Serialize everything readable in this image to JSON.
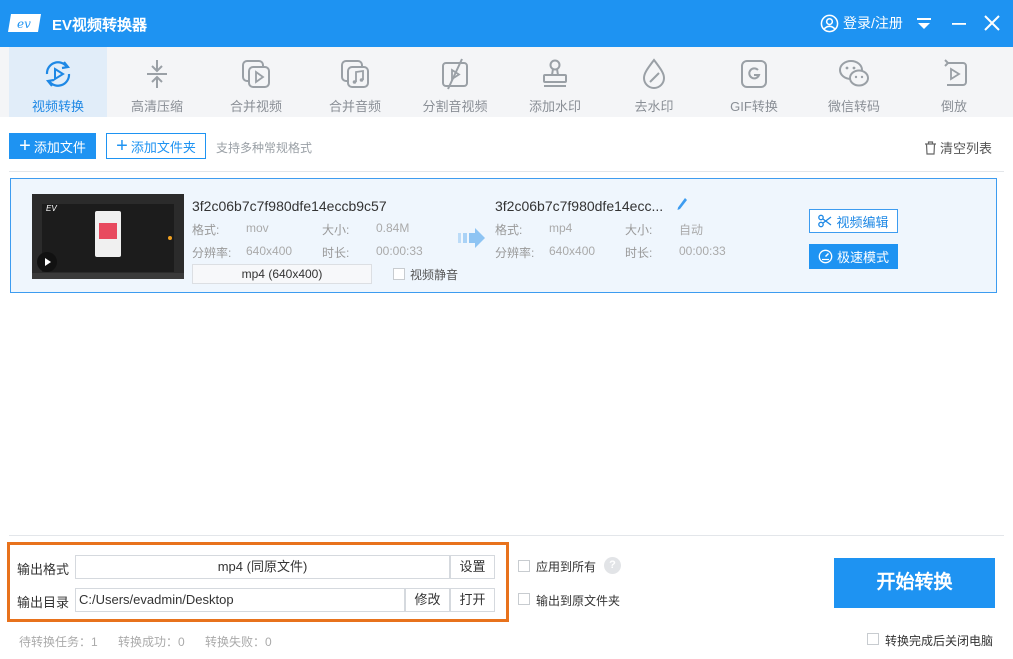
{
  "app": {
    "title": "EV视频转换器",
    "logo_text": "ev",
    "login": "登录/注册"
  },
  "toolbar": [
    {
      "label": "视频转换",
      "icon": "convert-icon",
      "active": true
    },
    {
      "label": "高清压缩",
      "icon": "compress-icon"
    },
    {
      "label": "合并视频",
      "icon": "merge-video-icon"
    },
    {
      "label": "合并音频",
      "icon": "merge-audio-icon"
    },
    {
      "label": "分割音视频",
      "icon": "split-icon"
    },
    {
      "label": "添加水印",
      "icon": "watermark-icon"
    },
    {
      "label": "去水印",
      "icon": "remove-watermark-icon"
    },
    {
      "label": "GIF转换",
      "icon": "gif-icon"
    },
    {
      "label": "微信转码",
      "icon": "wechat-icon"
    },
    {
      "label": "倒放",
      "icon": "reverse-icon"
    }
  ],
  "actions": {
    "add_file": "添加文件",
    "add_folder": "添加文件夹",
    "support": "支持多种常规格式",
    "clear": "清空列表"
  },
  "file": {
    "thumb_logo": "EV",
    "source": {
      "name": "3f2c06b7c7f980dfe14eccb9c57",
      "format_label": "格式:",
      "format": "mov",
      "size_label": "大小:",
      "size": "0.84M",
      "res_label": "分辨率:",
      "res": "640x400",
      "duration_label": "时长:",
      "duration": "00:00:33"
    },
    "output_format": "mp4 (640x400)",
    "mute_label": "视频静音",
    "target": {
      "name": "3f2c06b7c7f980dfe14ecc...",
      "format_label": "格式:",
      "format": "mp4",
      "size_label": "大小:",
      "size": "自动",
      "res_label": "分辨率:",
      "res": "640x400",
      "duration_label": "时长:",
      "duration": "00:00:33"
    },
    "edit_btn": "视频编辑",
    "speed_btn": "极速模式"
  },
  "output": {
    "format_label": "输出格式",
    "format_value": "mp4 (同原文件)",
    "settings_btn": "设置",
    "dir_label": "输出目录",
    "dir_value": "C:/Users/evadmin/Desktop",
    "modify_btn": "修改",
    "open_btn": "打开",
    "apply_all": "应用到所有",
    "help": "?",
    "to_source": "输出到原文件夹",
    "start": "开始转换"
  },
  "status": {
    "pending": "待转换任务：1",
    "success": "转换成功：0",
    "failed": "转换失败：0",
    "shutdown": "转换完成后关闭电脑"
  },
  "colors": {
    "primary": "#1e93f2",
    "highlight": "#e8721c"
  }
}
